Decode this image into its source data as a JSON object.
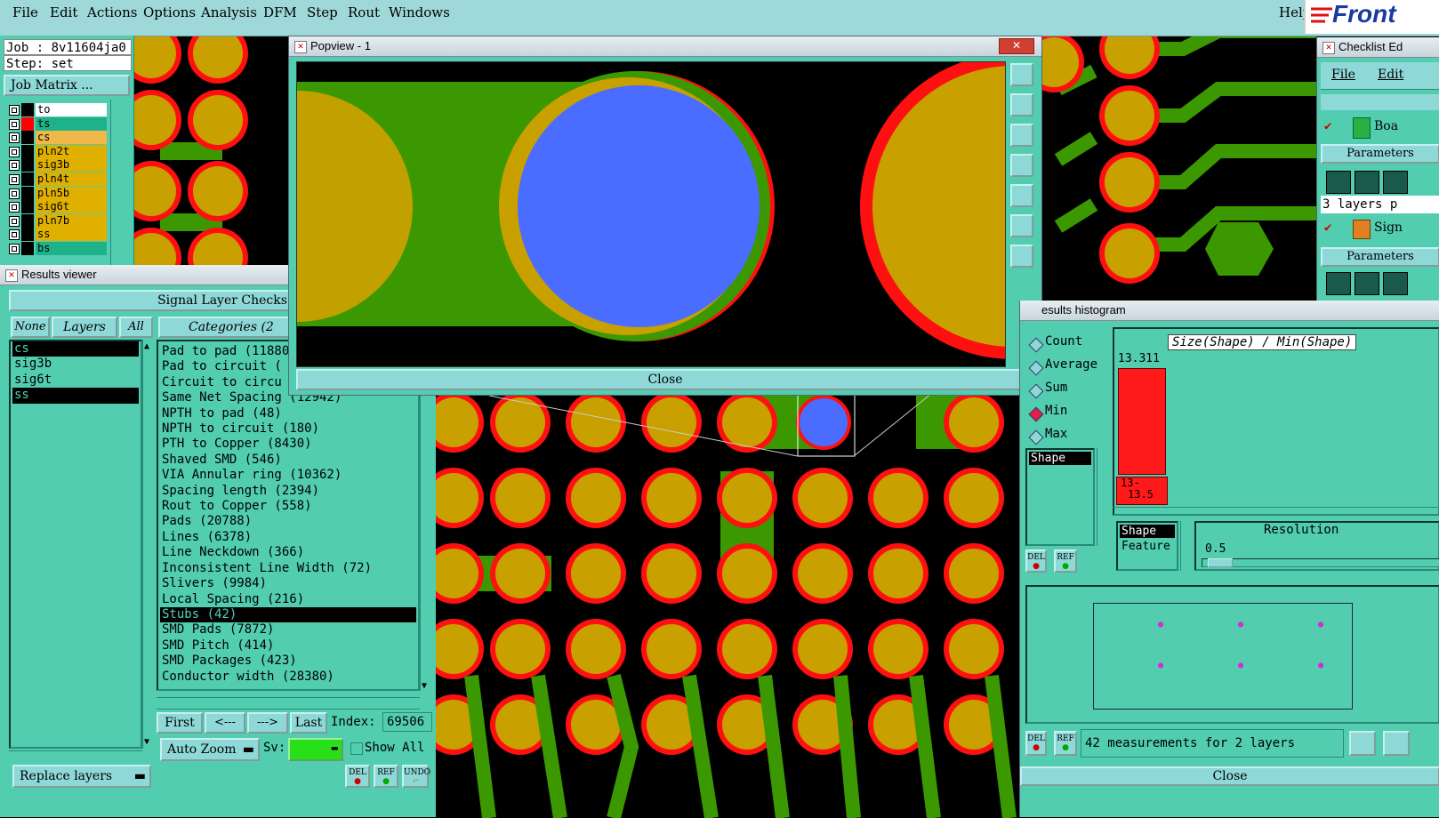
{
  "menubar": {
    "items": [
      "File",
      "Edit",
      "Actions",
      "Options",
      "Analysis",
      "DFM",
      "Step",
      "Rout",
      "Windows"
    ],
    "help": "Help",
    "logo": "Front"
  },
  "job": {
    "job_line": "Job : 8v11604ja0",
    "step_line": "Step: set",
    "matrix_button": "Job Matrix ..."
  },
  "layers": [
    {
      "name": "to",
      "color": "#ffffff",
      "swatch": "#000000"
    },
    {
      "name": "ts",
      "color": "#1fb28a",
      "swatch": "#ff0000"
    },
    {
      "name": "cs",
      "color": "#f0b848",
      "swatch": "#000000"
    },
    {
      "name": "pln2t",
      "color": "#e0b000",
      "swatch": "#000000"
    },
    {
      "name": "sig3b",
      "color": "#e0b000",
      "swatch": "#000000"
    },
    {
      "name": "pln4t",
      "color": "#e0b000",
      "swatch": "#000000"
    },
    {
      "name": "pln5b",
      "color": "#e0b000",
      "swatch": "#000000"
    },
    {
      "name": "sig6t",
      "color": "#e0b000",
      "swatch": "#000000"
    },
    {
      "name": "pln7b",
      "color": "#e0b000",
      "swatch": "#000000"
    },
    {
      "name": "ss",
      "color": "#e0b000",
      "swatch": "#000000"
    },
    {
      "name": "bs",
      "color": "#1fb28a",
      "swatch": "#000000"
    }
  ],
  "results_viewer": {
    "title": "Results viewer",
    "header": "Signal Layer Checks",
    "none_btn": "None",
    "layers_btn": "Layers",
    "all_btn": "All",
    "categories_label": "Categories (2",
    "layer_list": [
      {
        "name": "cs",
        "selected": true
      },
      {
        "name": "sig3b",
        "selected": false
      },
      {
        "name": "sig6t",
        "selected": false
      },
      {
        "name": "ss",
        "selected": true
      }
    ],
    "categories": [
      {
        "label": "Pad to pad (11880",
        "selected": false
      },
      {
        "label": "Pad to circuit (",
        "selected": false
      },
      {
        "label": "Circuit to circu",
        "selected": false
      },
      {
        "label": "Same Net Spacing (12942)",
        "selected": false
      },
      {
        "label": "NPTH to pad (48)",
        "selected": false
      },
      {
        "label": "NPTH to circuit (180)",
        "selected": false
      },
      {
        "label": "PTH to Copper (8430)",
        "selected": false
      },
      {
        "label": "Shaved SMD (546)",
        "selected": false
      },
      {
        "label": "VIA Annular ring (10362)",
        "selected": false
      },
      {
        "label": "Spacing length (2394)",
        "selected": false
      },
      {
        "label": "Rout to Copper (558)",
        "selected": false
      },
      {
        "label": "Pads (20788)",
        "selected": false
      },
      {
        "label": "Lines (6378)",
        "selected": false
      },
      {
        "label": "Line Neckdown (366)",
        "selected": false
      },
      {
        "label": "Inconsistent Line Width (72)",
        "selected": false
      },
      {
        "label": "Slivers (9984)",
        "selected": false
      },
      {
        "label": "Local Spacing (216)",
        "selected": false
      },
      {
        "label": "Stubs (42)",
        "selected": true
      },
      {
        "label": "SMD Pads (7872)",
        "selected": false
      },
      {
        "label": "SMD Pitch (414)",
        "selected": false
      },
      {
        "label": "SMD Packages (423)",
        "selected": false
      },
      {
        "label": "Conductor width (28380)",
        "selected": false
      }
    ],
    "nav": {
      "first": "First",
      "prev": "<---",
      "next": "--->",
      "last": "Last",
      "index_label": "Index:",
      "index_value": "69506"
    },
    "auto_zoom": "Auto Zoom",
    "sv_label": "Sv:",
    "show_all": "Show All",
    "replace_layers": "Replace layers",
    "del": "DEL",
    "ref": "REF",
    "undo": "UNDO"
  },
  "popview": {
    "title": "Popview - 1",
    "close": "Close"
  },
  "checklist": {
    "title": "Checklist Ed",
    "menu_file": "File",
    "menu_edit": "Edit",
    "row1": "Boa",
    "params": "Parameters",
    "layers_text": "3 layers p",
    "row2": "Sign",
    "params2": "Parameters"
  },
  "histogram": {
    "title": "esults histogram",
    "options": [
      {
        "label": "Count",
        "selected": false
      },
      {
        "label": "Average",
        "selected": false
      },
      {
        "label": "Sum",
        "selected": false
      },
      {
        "label": "Min",
        "selected": true
      },
      {
        "label": "Max",
        "selected": false
      }
    ],
    "list_item": "Shape",
    "chart_title": "Size(Shape) / Min(Shape)",
    "bar_value": "13.311",
    "bar_label_1": "13-",
    "bar_label_2": "13.5",
    "shape_list": [
      "Shape",
      "Feature"
    ],
    "resolution_label": "Resolution",
    "resolution_value": "0.5",
    "summary": "42 measurements for 2 layers",
    "close": "Close",
    "del": "DEL",
    "ref": "REF"
  },
  "colors": {
    "teal": "#52cdb0",
    "pad_gold": "#c8a000",
    "pad_ring": "#ff1010",
    "trace": "#3c9800",
    "via_blue": "#4a6cff"
  }
}
